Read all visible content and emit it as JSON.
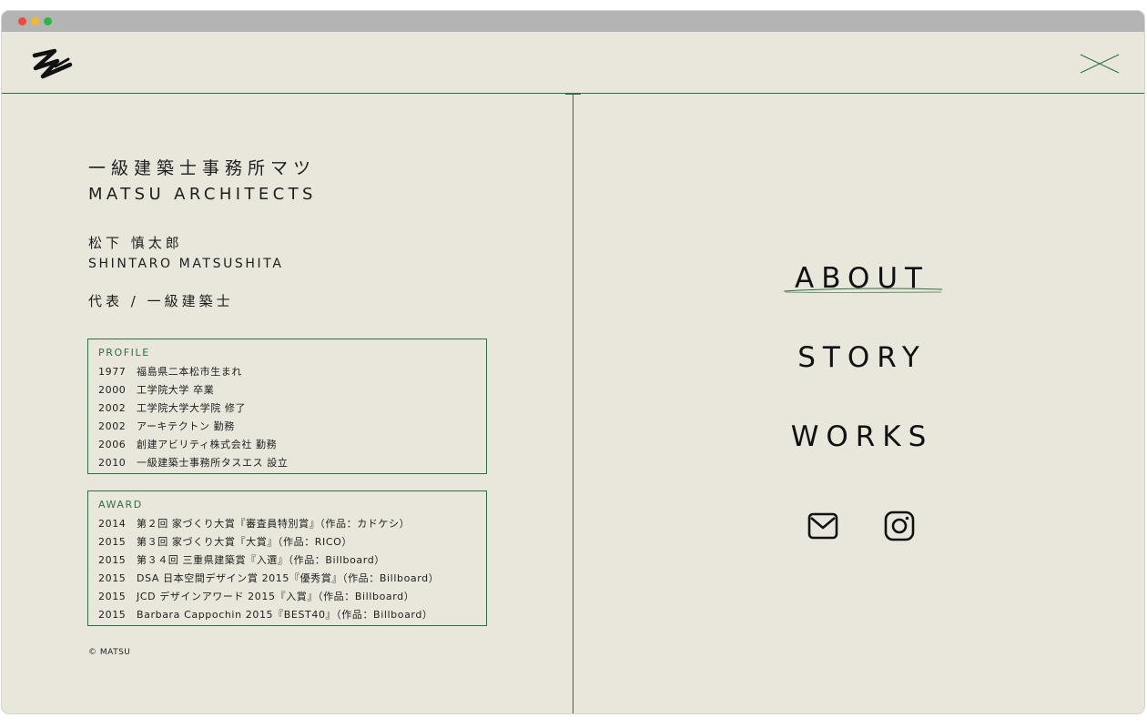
{
  "window": {
    "controls": [
      "close",
      "minimize",
      "maximize"
    ]
  },
  "header": {
    "logo": "matsu-logo",
    "close_icon": "close-icon"
  },
  "firm": {
    "name_jp": "一級建築士事務所マツ",
    "name_en": "MATSU ARCHITECTS"
  },
  "person": {
    "name_jp": "松下 慎太郎",
    "name_en": "SHINTARO MATSUSHITA",
    "title_jp": "代表 / 一級建築士"
  },
  "profile": {
    "title": "PROFILE",
    "items": [
      {
        "year": "1977",
        "text": "福島県二本松市生まれ"
      },
      {
        "year": "2000",
        "text": "工学院大学 卒業"
      },
      {
        "year": "2002",
        "text": "工学院大学大学院 修了"
      },
      {
        "year": "2002",
        "text": "アーキテクトン 勤務"
      },
      {
        "year": "2006",
        "text": "創建アビリティ株式会社 勤務"
      },
      {
        "year": "2010",
        "text": "一級建築士事務所タスエス 設立"
      }
    ]
  },
  "award": {
    "title": "AWARD",
    "items": [
      {
        "year": "2014",
        "text": "第２回 家づくり大賞『審査員特別賞』（作品：カドケシ）"
      },
      {
        "year": "2015",
        "text": "第３回 家づくり大賞『大賞』（作品：RICO）"
      },
      {
        "year": "2015",
        "text": "第３４回 三重県建築賞『入選』（作品：Billboard）"
      },
      {
        "year": "2015",
        "text": "DSA 日本空間デザイン賞 2015『優秀賞』（作品：Billboard）"
      },
      {
        "year": "2015",
        "text": "JCD デザインアワード 2015『入賞』（作品：Billboard）"
      },
      {
        "year": "2015",
        "text": "Barbara Cappochin 2015『BEST40』（作品：Billboard）"
      }
    ]
  },
  "copyright": "© MATSU",
  "nav": {
    "about": "ABOUT",
    "story": "STORY",
    "works": "WORKS"
  },
  "social": {
    "mail_icon": "mail-icon",
    "instagram_icon": "instagram-icon"
  },
  "colors": {
    "background": "#e9e7dc",
    "accent_green": "#2f6e44",
    "text": "#1d1d1d",
    "titlebar": "#b4b4b4"
  }
}
